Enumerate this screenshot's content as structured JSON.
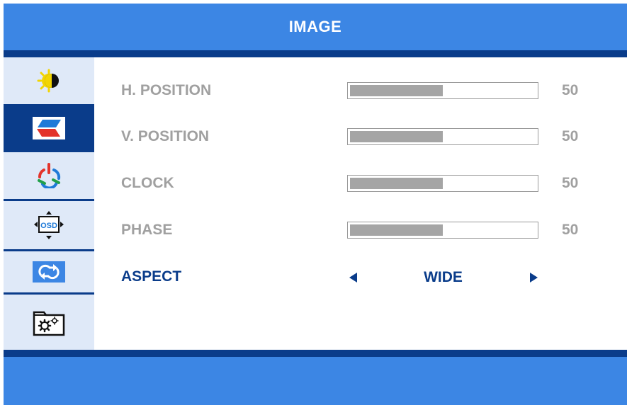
{
  "header": {
    "title": "IMAGE"
  },
  "sidebar": {
    "items": [
      {
        "icon": "brightness-contrast-icon",
        "selected": false
      },
      {
        "icon": "image-position-icon",
        "selected": true
      },
      {
        "icon": "color-rgb-icon",
        "selected": false
      },
      {
        "icon": "osd-settings-icon",
        "selected": false
      },
      {
        "icon": "reset-arrows-icon",
        "selected": false
      },
      {
        "icon": "folder-gear-icon",
        "selected": false
      }
    ]
  },
  "settings": [
    {
      "label": "H. POSITION",
      "value": "50",
      "level": 0.5
    },
    {
      "label": "V. POSITION",
      "value": "50",
      "level": 0.5
    },
    {
      "label": "CLOCK",
      "value": "50",
      "level": 0.5
    },
    {
      "label": "PHASE",
      "value": "50",
      "level": 0.5
    }
  ],
  "aspect": {
    "label": "ASPECT",
    "value": "WIDE"
  },
  "colors": {
    "header": "#3c86e4",
    "accent": "#0a3c8a",
    "sidebar": "#dfe9f8",
    "inactive_text": "#a0a0a0",
    "bar_fill": "#a5a5a5"
  }
}
